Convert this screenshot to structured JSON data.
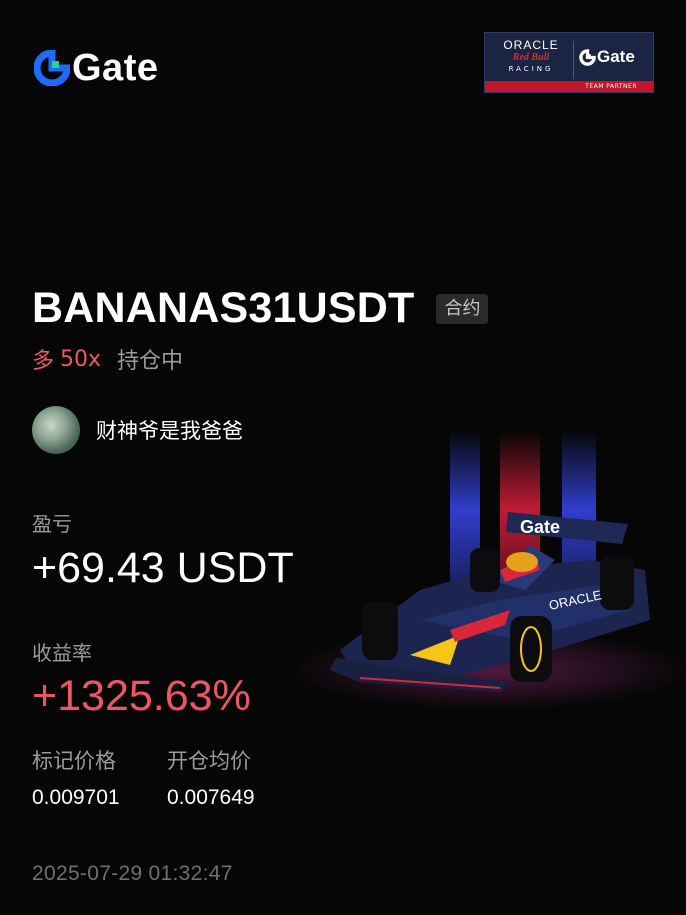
{
  "header": {
    "brand": "Gate",
    "partner": {
      "oracle": "ORACLE",
      "redbull": "Red Bull",
      "racing": "RACING",
      "gate": "Gate",
      "strip": "TEAM PARTNER"
    }
  },
  "position": {
    "pair": "BANANAS31USDT",
    "type_badge": "合约",
    "side": "多",
    "leverage": "50x",
    "status": "持仓中"
  },
  "user": {
    "name": "财神爷是我爸爸"
  },
  "pnl": {
    "label": "盈亏",
    "value": "+69.43 USDT"
  },
  "roi": {
    "label": "收益率",
    "value": "+1325.63%"
  },
  "prices": {
    "mark": {
      "label": "标记价格",
      "value": "0.009701"
    },
    "entry": {
      "label": "开仓均价",
      "value": "0.007649"
    }
  },
  "timestamp": "2025-07-29 01:32:47",
  "colors": {
    "background": "#060606",
    "profit_red": "#ef5663",
    "muted_text": "#9b9b9b",
    "brand_blue": "#1f6bff",
    "brand_green": "#21d19f"
  },
  "icons": {
    "brand_logo": "gate-logo-icon",
    "avatar": "user-avatar"
  }
}
